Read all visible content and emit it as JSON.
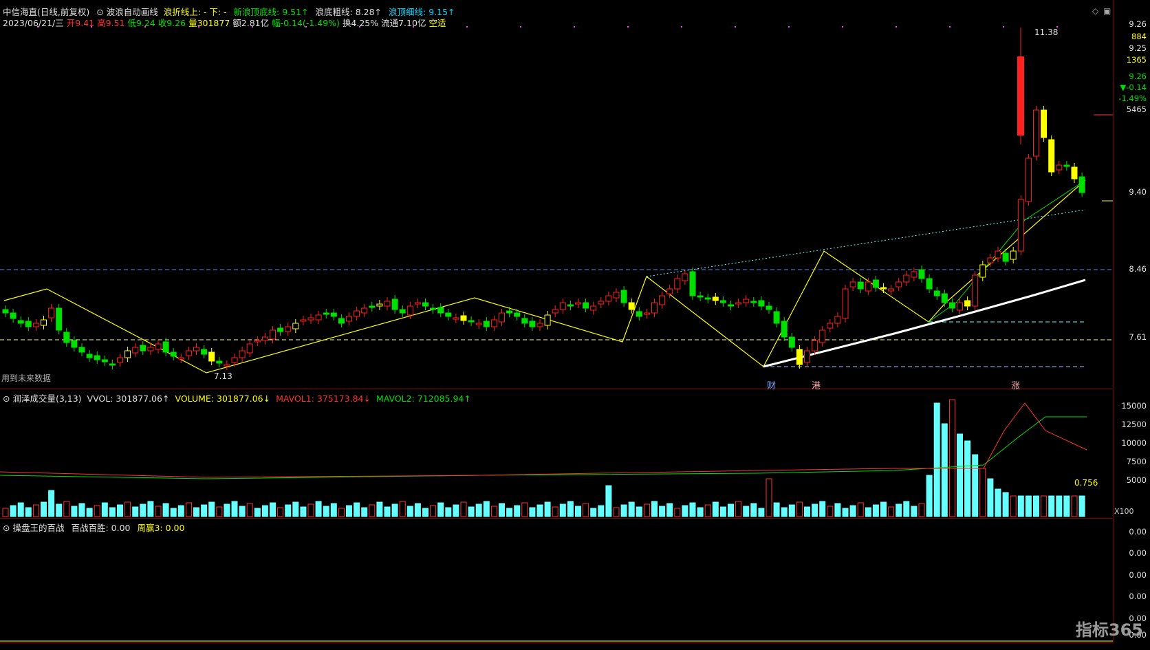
{
  "main": {
    "stock_name": "中信海直(日线,前复权)",
    "indicator_name": "波浪自动画线",
    "wave_line_label": "浪折线上: - 下: -",
    "new_top_bottom_label": "新浪顶底线: 9.51↑",
    "bottom_thick_label": "浪底粗线: 8.28↑",
    "top_thin_label": "浪顶细线: 9.15↑",
    "date": "2023/06/21/三",
    "open_label": "开9.41",
    "high_label": "高9.51",
    "low_label": "低9.24",
    "close_label": "收9.26",
    "volume_label": "量301877",
    "amount_label": "额2.81亿",
    "change_label": "幅-0.14(-1.49%)",
    "turnover_label": "换4.25%",
    "float_label": "流通7.10亿",
    "status_label": "空适",
    "future_data_note": "用到未来数据",
    "peak_label": "11.38",
    "trough_label": "7.13",
    "markers": [
      "财",
      "港",
      "涨"
    ],
    "price_axis": [
      "9.26",
      "884",
      "9.25",
      "1365",
      "9.26",
      "▼-0.14",
      "-1.49%",
      "5465",
      "9.40",
      "8.46",
      "7.61"
    ]
  },
  "volume_panel": {
    "name": "润泽成交量(3,13)",
    "vvol_label": "VVOL: 301877.06↑",
    "volume_label": "VOLUME: 301877.06↓",
    "mavol1_label": "MAVOL1: 375173.84↓",
    "mavol2_label": "MAVOL2: 712085.94↑",
    "last_value": "0.756",
    "axis": [
      "15000",
      "12500",
      "10000",
      "7500",
      "5000"
    ],
    "multiplier": "X100"
  },
  "indicator_panel": {
    "name": "操盘王的百战",
    "win_label": "百战百胜: 0.00",
    "week_label": "周赢3: 0.00",
    "axis": [
      "0.00",
      "0.00",
      "0.00",
      "0.00",
      "0.00"
    ],
    "corner_value": "0.00"
  },
  "watermark": "指标365",
  "colors": {
    "up": "#ff2020",
    "down": "#00e000",
    "yellow": "#ffff00",
    "cyan": "#66ffff",
    "border": "#8b0000"
  }
}
